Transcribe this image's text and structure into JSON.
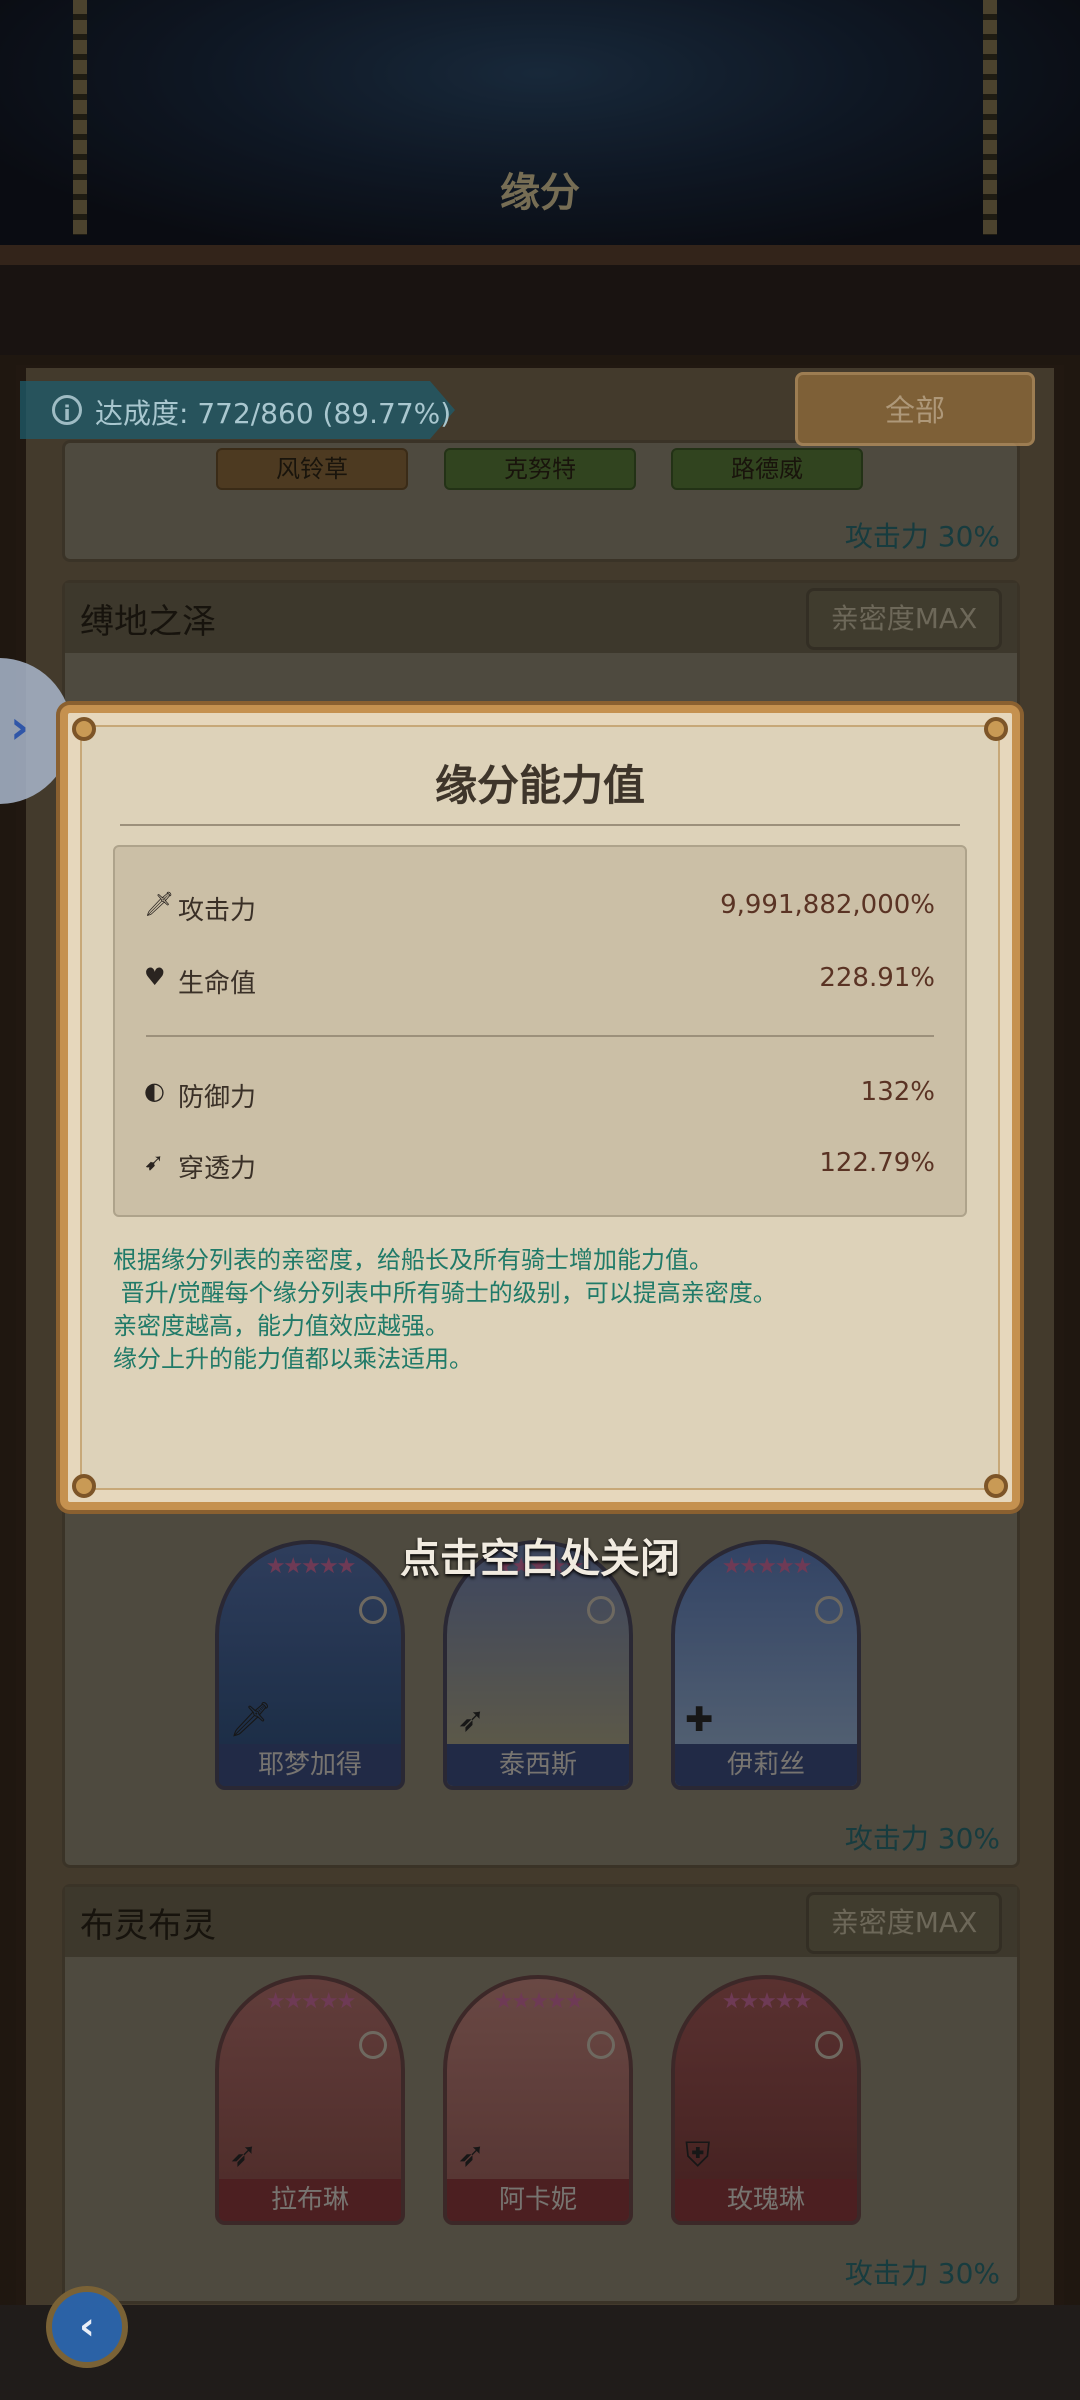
{
  "header": {
    "title": "缘分"
  },
  "progress": {
    "text": "达成度: 772/860 (89.77%)",
    "filter_label": "全部"
  },
  "top_partial": {
    "tags": [
      "风铃草",
      "克努特",
      "路德威"
    ],
    "stat": "攻击力 30%"
  },
  "groups": [
    {
      "name": "缚地之泽",
      "badge": "亲密度MAX",
      "heroes": [
        {
          "name": "耶梦加得",
          "class_icon": "sword-icon"
        },
        {
          "name": "泰西斯",
          "class_icon": "bow-icon"
        },
        {
          "name": "伊莉丝",
          "class_icon": "plus-icon"
        }
      ],
      "stat": "攻击力 30%"
    },
    {
      "name": "布灵布灵",
      "badge": "亲密度MAX",
      "heroes": [
        {
          "name": "拉布琳",
          "class_icon": "bow-icon"
        },
        {
          "name": "阿卡妮",
          "class_icon": "bow-icon"
        },
        {
          "name": "玫瑰琳",
          "class_icon": "shield-icon"
        }
      ],
      "stat": "攻击力 30%"
    }
  ],
  "popup": {
    "title": "缘分能力值",
    "stats": [
      {
        "label": "攻击力",
        "value": "9,991,882,000%",
        "icon": "sword-icon"
      },
      {
        "label": "生命值",
        "value": "228.91%",
        "icon": "heart-icon"
      },
      {
        "label": "防御力",
        "value": "132%",
        "icon": "shield-icon"
      },
      {
        "label": "穿透力",
        "value": "122.79%",
        "icon": "pierce-icon"
      }
    ],
    "description": [
      "根据缘分列表的亲密度，给船长及所有骑士增加能力值。",
      " 晋升/觉醒每个缘分列表中所有骑士的级别，可以提高亲密度。",
      "亲密度越高，能力值效应越强。",
      "缘分上升的能力值都以乘法适用。"
    ],
    "close_hint": "点击空白处关闭"
  },
  "colors": {
    "accent": "#c5914f",
    "stat_text": "#2b6d74",
    "desc_text": "#207a68"
  }
}
